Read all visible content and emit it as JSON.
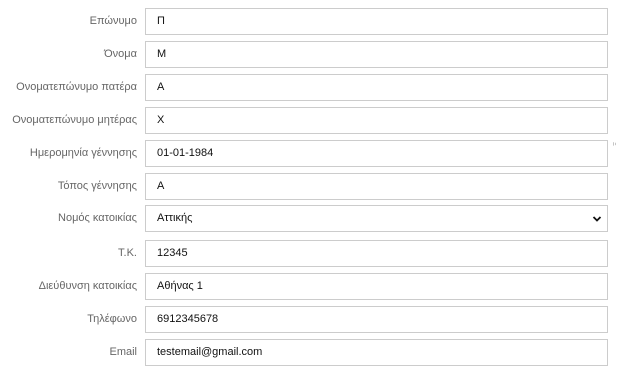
{
  "form": {
    "fields": [
      {
        "label": "Επώνυμο",
        "value": "Π"
      },
      {
        "label": "Όνομα",
        "value": "Μ"
      },
      {
        "label": "Ονοματεπώνυμο πατέρα",
        "value": "Α"
      },
      {
        "label": "Ονοματεπώνυμο μητέρας",
        "value": "Χ"
      },
      {
        "label": "Ημερομηνία γέννησης",
        "value": "01-01-1984"
      },
      {
        "label": "Τόπος γέννησης",
        "value": "Α"
      },
      {
        "label": "Νομός κατοικίας",
        "value": "Αττικής"
      },
      {
        "label": "Τ.Κ.",
        "value": "12345"
      },
      {
        "label": "Διεύθυνση κατοικίας",
        "value": "Αθήνας 1"
      },
      {
        "label": "Τηλέφωνο",
        "value": "6912345678"
      },
      {
        "label": "Email",
        "value": "testemail@gmail.com"
      }
    ],
    "side_text": "Ξ"
  },
  "icons": {
    "select_arrow": "chevron-down-icon"
  },
  "colors": {
    "label": "#666666",
    "field_border": "#cccccc",
    "field_text": "#111111",
    "background": "#ffffff"
  }
}
